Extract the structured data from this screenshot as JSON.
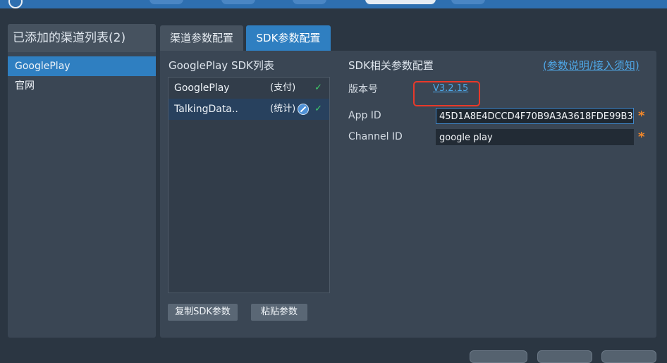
{
  "left_panel": {
    "title": "已添加的渠道列表(2)",
    "channels": [
      {
        "label": "GooglePlay"
      },
      {
        "label": "官网"
      }
    ]
  },
  "tabs": [
    {
      "label": "渠道参数配置"
    },
    {
      "label": "SDK参数配置"
    }
  ],
  "sdk_list": {
    "title": "GooglePlay SDK列表",
    "items": [
      {
        "name": "GooglePlay",
        "type": "(支付)",
        "check": "✓"
      },
      {
        "name": "TalkingData..",
        "type": "(统计)",
        "check": "✓"
      }
    ],
    "copy_button": "复制SDK参数",
    "paste_button": "粘贴参数"
  },
  "config": {
    "title": "SDK相关参数配置",
    "help_link": "(参数说明/接入须知)",
    "version_label": "版本号",
    "version_value": "V3.2.15",
    "app_id_label": "App ID",
    "app_id_value": "45D1A8E4DCCD4F70B9A3A3618FDE99B3",
    "channel_id_label": "Channel ID",
    "channel_id_value": "google play",
    "required_mark": "*"
  },
  "colors": {
    "accent": "#2f7fc1",
    "link": "#4fa8e8",
    "highlight": "#e8392a",
    "required": "#f0872a",
    "check": "#3ecf6b"
  }
}
